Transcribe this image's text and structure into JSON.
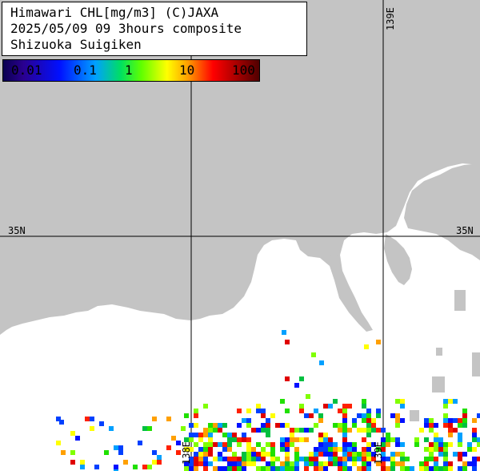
{
  "title": {
    "line1": "Himawari CHL[mg/m3] (C)JAXA",
    "line2": "2025/05/09 09 3hours composite",
    "line3": "Shizuoka Suigiken"
  },
  "legend": {
    "labels": [
      "0.01",
      "0.1",
      "1",
      "10",
      "100"
    ]
  },
  "grid": {
    "lat_label_left": "35N",
    "lat_label_right": "35N",
    "lon_label_top": "139E",
    "lon_label_bottom_a": "138E",
    "lon_label_bottom_b": "139E"
  },
  "colors": {
    "land": "#c4c4c4",
    "sea": "#ffffff",
    "gridline": "#000000"
  }
}
